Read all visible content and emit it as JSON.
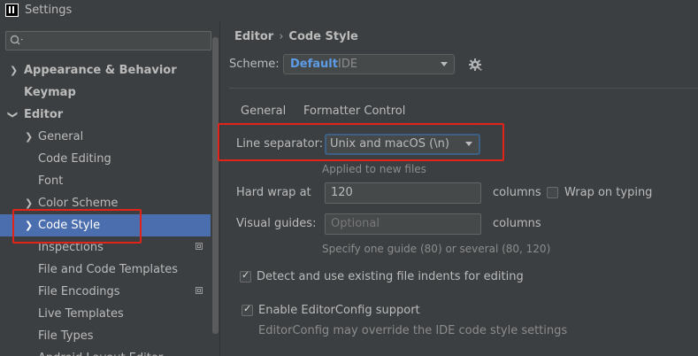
{
  "window": {
    "title": "Settings"
  },
  "search": {
    "placeholder": ""
  },
  "sidebar": {
    "items": [
      {
        "label": "Appearance & Behavior"
      },
      {
        "label": "Keymap"
      },
      {
        "label": "Editor"
      },
      {
        "label": "General"
      },
      {
        "label": "Code Editing"
      },
      {
        "label": "Font"
      },
      {
        "label": "Color Scheme"
      },
      {
        "label": "Code Style"
      },
      {
        "label": "Inspections"
      },
      {
        "label": "File and Code Templates"
      },
      {
        "label": "File Encodings"
      },
      {
        "label": "Live Templates"
      },
      {
        "label": "File Types"
      },
      {
        "label": "Android Layout Editor"
      }
    ]
  },
  "breadcrumb": {
    "parent": "Editor",
    "separator": "›",
    "current": "Code Style"
  },
  "scheme": {
    "label": "Scheme:",
    "name": "Default",
    "tag": "IDE"
  },
  "tabs": [
    {
      "label": "General"
    },
    {
      "label": "Formatter Control"
    }
  ],
  "form": {
    "line_separator_label": "Line separator:",
    "line_separator_value": "Unix and macOS (\\n)",
    "applied_hint": "Applied to new files",
    "hard_wrap_label": "Hard wrap at",
    "hard_wrap_value": "120",
    "columns_label": "columns",
    "wrap_on_typing_label": "Wrap on typing",
    "visual_guides_label": "Visual guides:",
    "visual_guides_placeholder": "Optional",
    "visual_guides_columns": "columns",
    "guides_hint": "Specify one guide (80) or several (80, 120)",
    "detect_indents_label": "Detect and use existing file indents for editing",
    "editorconfig_label": "Enable EditorConfig support",
    "editorconfig_hint": "EditorConfig may override the IDE code style settings"
  },
  "colors": {
    "selection": "#4b6eaf",
    "highlight_box": "#e2231a",
    "scheme_name": "#5c9ce6"
  }
}
